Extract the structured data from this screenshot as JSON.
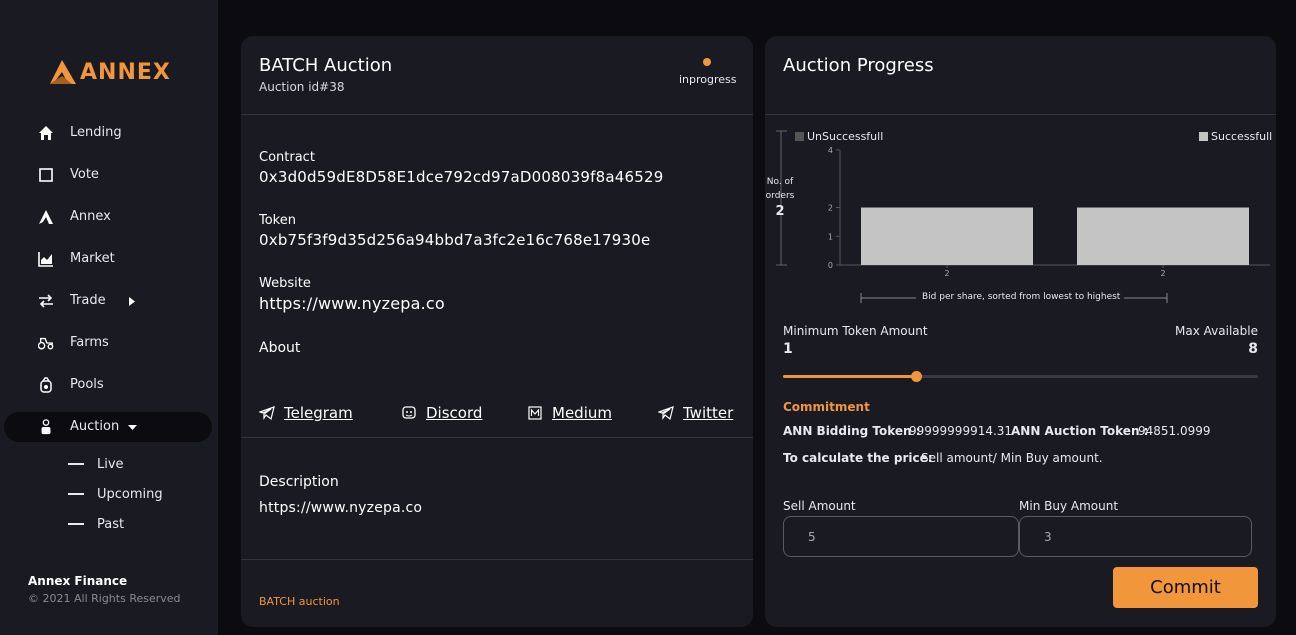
{
  "brand": {
    "logo_text": "ANNEX",
    "accent": "#f1963a"
  },
  "sidebar": {
    "items": [
      {
        "label": "Lending",
        "icon": "home-icon"
      },
      {
        "label": "Vote",
        "icon": "checkbox-icon"
      },
      {
        "label": "Annex",
        "icon": "annex-logo-icon"
      },
      {
        "label": "Market",
        "icon": "chart-icon"
      },
      {
        "label": "Trade",
        "icon": "swap-icon"
      },
      {
        "label": "Farms",
        "icon": "tractor-icon"
      },
      {
        "label": "Pools",
        "icon": "pool-icon"
      },
      {
        "label": "Auction",
        "icon": "auction-icon"
      }
    ],
    "auction_sub": [
      {
        "label": "Live"
      },
      {
        "label": "Upcoming"
      },
      {
        "label": "Past"
      }
    ],
    "footer_title": "Annex Finance",
    "footer_copy": "© 2021 All Rights Reserved"
  },
  "auction": {
    "title": "BATCH Auction",
    "id_text": "Auction id#38",
    "status": "inprogress",
    "contract_label": "Contract",
    "contract": "0x3d0d59dE8D58E1dce792cd97aD008039f8a46529",
    "token_label": "Token",
    "token": "0xb75f3f9d35d256a94bbd7a3fc2e16c768e17930e",
    "website_label": "Website",
    "website": "https://www.nyzepa.co",
    "about_label": "About",
    "socials": [
      {
        "label": "Telegram",
        "icon": "telegram-icon"
      },
      {
        "label": "Discord",
        "icon": "discord-icon"
      },
      {
        "label": "Medium",
        "icon": "medium-icon"
      },
      {
        "label": "Twitter",
        "icon": "twitter-icon"
      }
    ],
    "description_label": "Description",
    "description": "https://www.nyzepa.co",
    "footer_tag": "BATCH auction"
  },
  "progress": {
    "title": "Auction Progress",
    "min_token_label": "Minimum Token Amount",
    "min_token_value": "1",
    "max_available_label": "Max Available",
    "max_available_value": "8",
    "slider_value": 1,
    "slider_min": 1,
    "slider_max": 8,
    "slider_fraction": 0.28,
    "commitment_label": "Commitment",
    "bidding_label": "ANN Bidding Token :",
    "bidding_value": "99999999914.31",
    "auction_token_label": "ANN Auction Token :",
    "auction_token_value": "94851.0999",
    "calc_label": "To calculate the price:",
    "calc_value": "Sell amount/ Min Buy amount.",
    "sell_label": "Sell Amount",
    "sell_value": "5",
    "minbuy_label": "Min Buy Amount",
    "minbuy_value": "3",
    "commit_label": "Commit"
  },
  "chart_data": {
    "type": "bar",
    "legend": [
      {
        "name": "UnSuccessfull",
        "color": "#555555"
      },
      {
        "name": "Successfull",
        "color": "#c4c4c4"
      }
    ],
    "y_side_label": "No. of orders",
    "y_side_value": "2",
    "yticks": [
      0,
      1,
      2,
      4
    ],
    "ylim": [
      0,
      4
    ],
    "categories": [
      "2",
      "2"
    ],
    "values": [
      2,
      2
    ],
    "xlabel": "Bid per share, sorted from lowest to highest",
    "bar_color": "#c4c4c4"
  }
}
